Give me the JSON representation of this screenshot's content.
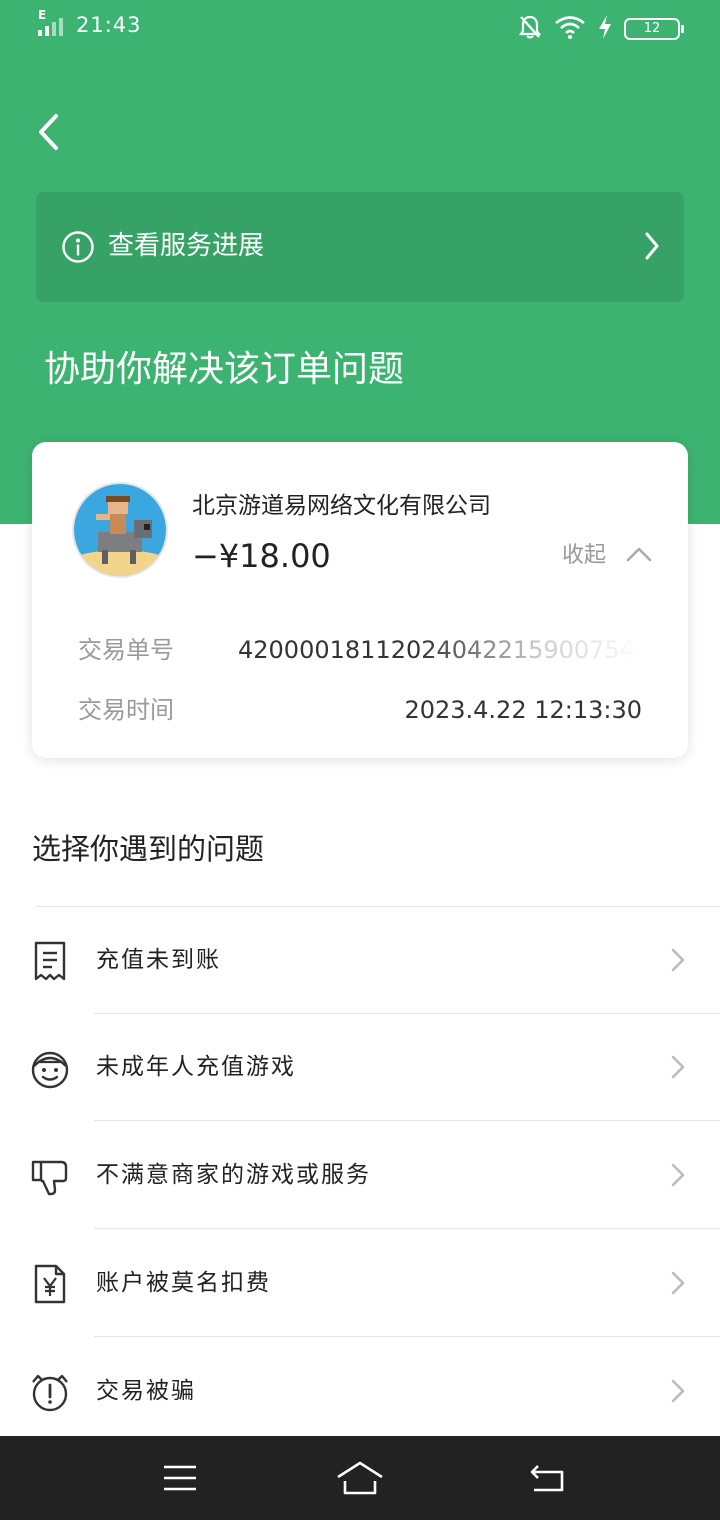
{
  "status_bar": {
    "network": "E",
    "time": "21:43",
    "battery": "12",
    "icons": [
      "mute-icon",
      "wifi-icon",
      "charging-icon",
      "battery-icon"
    ]
  },
  "header": {
    "back_icon": "back-arrow-icon",
    "service_progress": {
      "icon": "info-circle-icon",
      "label": "查看服务进展"
    },
    "headline": "协助你解决该订单问题"
  },
  "order_card": {
    "merchant": "北京游道易网络文化有限公司",
    "amount": "−¥18.00",
    "collapse_label": "收起",
    "details": [
      {
        "label": "交易单号",
        "value": "42000018112024042215900754"
      },
      {
        "label": "交易时间",
        "value": "2023.4.22 12:13:30"
      }
    ]
  },
  "issues": {
    "title": "选择你遇到的问题",
    "items": [
      {
        "icon": "receipt-icon",
        "label": "充值未到账"
      },
      {
        "icon": "child-face-icon",
        "label": "未成年人充值游戏"
      },
      {
        "icon": "thumbs-down-icon",
        "label": "不满意商家的游戏或服务"
      },
      {
        "icon": "yuan-document-icon",
        "label": "账户被莫名扣费"
      },
      {
        "icon": "alert-icon",
        "label": "交易被骗"
      }
    ]
  },
  "nav_bar": {
    "buttons": [
      "menu-icon",
      "home-icon",
      "back-icon"
    ]
  },
  "colors": {
    "header_green": "#3cb371",
    "service_bar_green": "#37a265",
    "nav_bar": "#222222"
  }
}
